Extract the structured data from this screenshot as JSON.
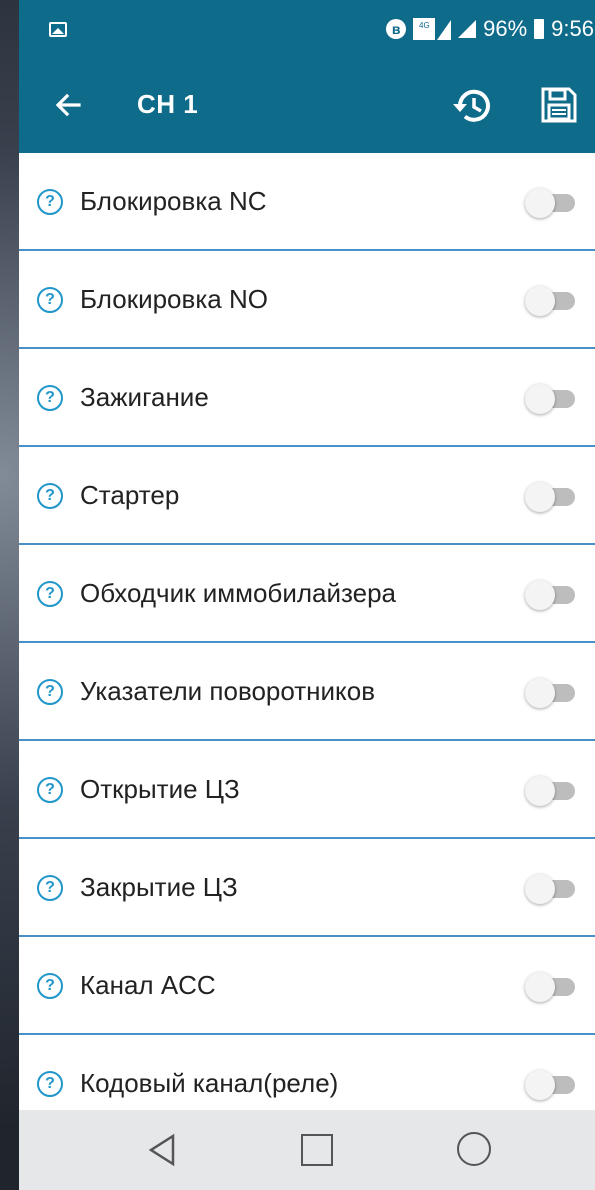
{
  "status_bar": {
    "battery": "96%",
    "time": "9:56",
    "network": "4G"
  },
  "app_bar": {
    "title": "CH 1"
  },
  "settings": [
    {
      "label": "Блокировка NC",
      "enabled": false
    },
    {
      "label": "Блокировка NO",
      "enabled": false
    },
    {
      "label": "Зажигание",
      "enabled": false
    },
    {
      "label": "Стартер",
      "enabled": false
    },
    {
      "label": "Обходчик иммобилайзера",
      "enabled": false
    },
    {
      "label": "Указатели поворотников",
      "enabled": false
    },
    {
      "label": "Открытие ЦЗ",
      "enabled": false
    },
    {
      "label": "Закрытие ЦЗ",
      "enabled": false
    },
    {
      "label": "Канал ACC",
      "enabled": false
    },
    {
      "label": "Кодовый канал(реле)",
      "enabled": false
    }
  ],
  "help_glyph": "?",
  "colors": {
    "primary": "#0f6b8a",
    "divider": "#4a8fc6",
    "help": "#2196c9",
    "navbar": "#e6e7e9"
  }
}
